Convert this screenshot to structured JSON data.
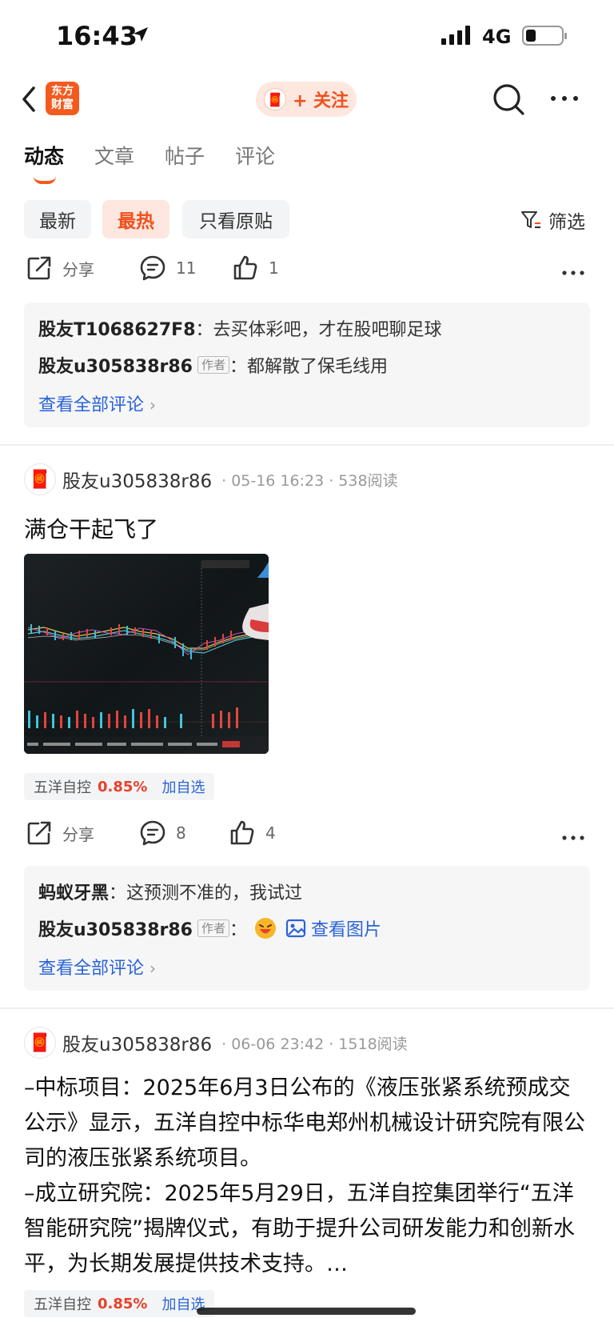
{
  "status_bar": {
    "time": "16:43",
    "network": "4G"
  },
  "nav": {
    "logo_line1": "东方",
    "logo_line2": "财富",
    "follow_label": "+ 关注"
  },
  "tabs": [
    {
      "label": "动态"
    },
    {
      "label": "文章"
    },
    {
      "label": "帖子"
    },
    {
      "label": "评论"
    }
  ],
  "filters": {
    "newest": "最新",
    "hottest": "最热",
    "original_only": "只看原贴",
    "filter_label": "筛选"
  },
  "post0": {
    "share_label": "分享",
    "comment_count": "11",
    "like_count": "1",
    "comments": [
      {
        "user": "股友T1068627F8",
        "sep": "：",
        "text": "去买体彩吧，才在股吧聊足球"
      },
      {
        "user": "股友u305838r86",
        "author_tag": "作者",
        "sep": "：",
        "text": "都解散了保毛线用"
      }
    ],
    "view_all": "查看全部评论"
  },
  "post1": {
    "user": "股友u305838r86",
    "meta": "· 05-16 16:23 · 538阅读",
    "title": "满仓干起飞了",
    "stock": {
      "name": "五洋自控",
      "change": "0.85%",
      "add": "加自选"
    },
    "share_label": "分享",
    "comment_count": "8",
    "like_count": "4",
    "comments": [
      {
        "user": "蚂蚁牙黑",
        "sep": "：",
        "text": "这预测不准的，我试过"
      },
      {
        "user": "股友u305838r86",
        "author_tag": "作者",
        "sep": "：",
        "link": "查看图片"
      }
    ],
    "view_all": "查看全部评论"
  },
  "post2": {
    "user": "股友u305838r86",
    "meta": "· 06-06 23:42 · 1518阅读",
    "body": "–中标项目：2025年6月3日公布的《液压张紧系统预成交公示》显示，五洋自控中标华电郑州机械设计研究院有限公司的液压张紧系统项目。\n–成立研究院：2025年5月29日，五洋自控集团举行“五洋智能研究院”揭牌仪式，有助于提升公司研发能力和创新水平，为长期发展提供技术支持。…",
    "stock": {
      "name": "五洋自控",
      "change": "0.85%",
      "add": "加自选"
    }
  },
  "colors": {
    "accent": "#f0501e",
    "link": "#2a63d8",
    "rise": "#e8402a"
  }
}
